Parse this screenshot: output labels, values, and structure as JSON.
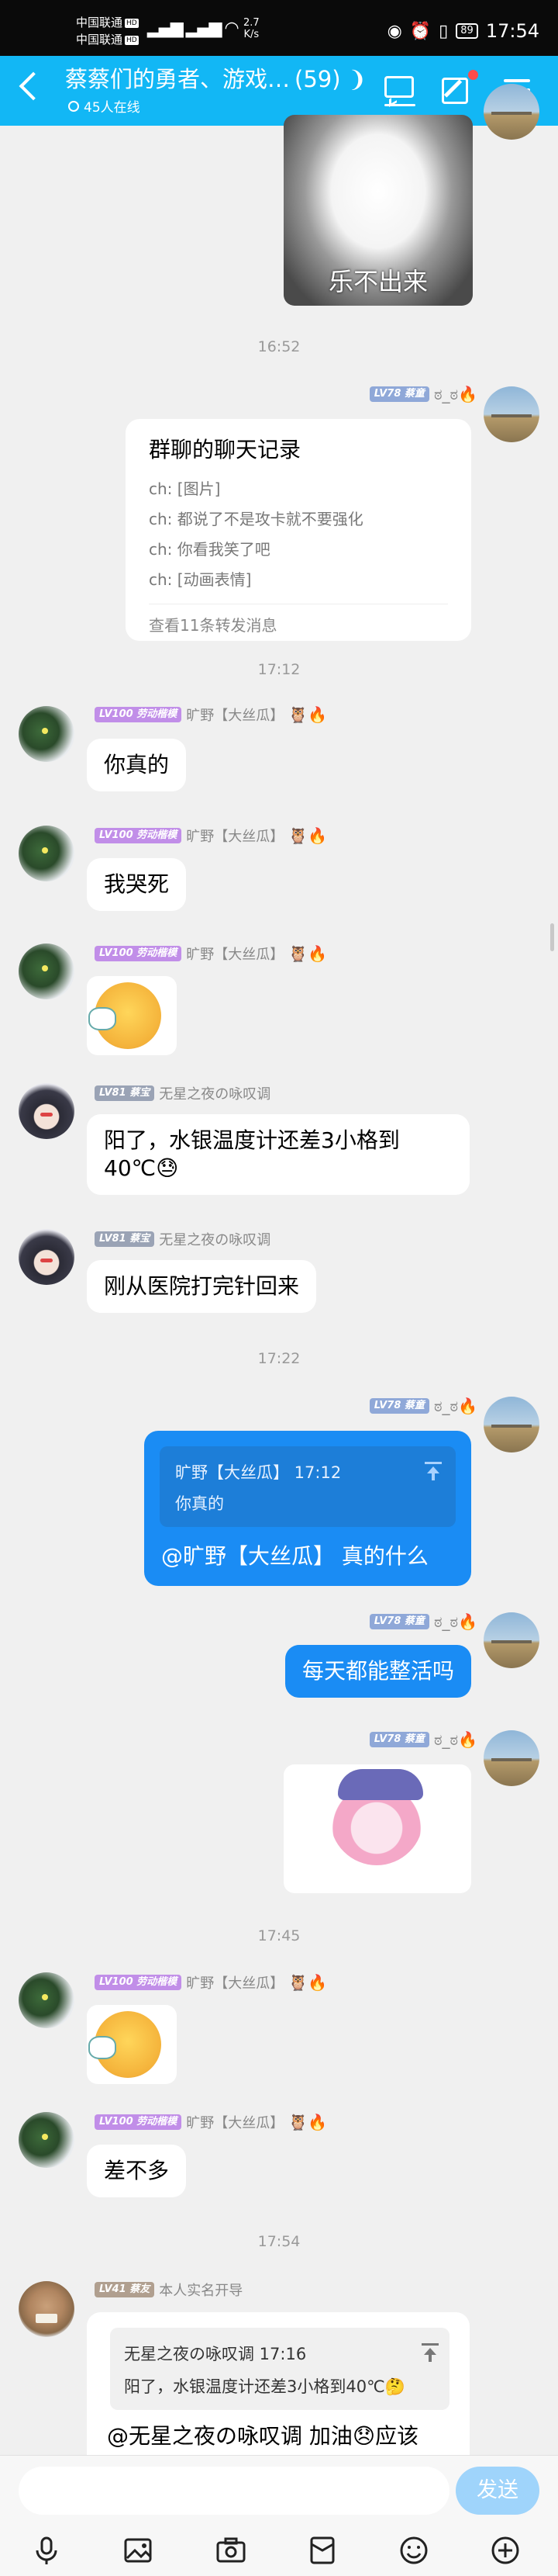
{
  "status_bar": {
    "carrier1": "中国联通",
    "carrier2": "中国联通",
    "hd": "HD",
    "speed_value": "2.7",
    "speed_unit": "K/s",
    "battery": "89",
    "time": "17:54"
  },
  "header": {
    "title": "蔡蔡们的勇者、游戏…",
    "member_count": "(59)",
    "online": "45人在线"
  },
  "messages": {
    "m1": {
      "image_caption": "乐不出来"
    },
    "t1": "16:52",
    "m2": {
      "level": "LV78",
      "name": "蔡童",
      "badge": "ಠ_ಠ🔥",
      "forward_title": "群聊的聊天记录",
      "forward_lines": [
        "ch: [图片]",
        "ch: 都说了不是攻卡就不要强化",
        "ch: 你看我笑了吧",
        "ch: [动画表情]"
      ],
      "forward_more": "查看11条转发消息"
    },
    "t2": "17:12",
    "m3": {
      "level": "LV100",
      "name": "劳动楷模",
      "title": "旷野【大丝瓜】",
      "badge": "🦉🔥",
      "text": "你真的"
    },
    "m4": {
      "level": "LV100",
      "name": "劳动楷模",
      "title": "旷野【大丝瓜】",
      "badge": "🦉🔥",
      "text": "我哭死"
    },
    "m5": {
      "level": "LV100",
      "name": "劳动楷模",
      "title": "旷野【大丝瓜】",
      "badge": "🦉🔥"
    },
    "m6": {
      "level": "LV81",
      "name": "蔡宝",
      "title": "无星之夜の咏叹调",
      "text": "阳了，水银温度计还差3小格到",
      "text2": "40℃😓"
    },
    "m7": {
      "level": "LV81",
      "name": "蔡宝",
      "title": "无星之夜の咏叹调",
      "text": "刚从医院打完针回来"
    },
    "t3": "17:22",
    "m8": {
      "level": "LV78",
      "name": "蔡童",
      "badge": "ಠ_ಠ🔥",
      "quote_head": "旷野【大丝瓜】 17:12",
      "quote_text": "你真的",
      "text": "@旷野【大丝瓜】 真的什么"
    },
    "m9": {
      "level": "LV78",
      "name": "蔡童",
      "badge": "ಠ_ಠ🔥",
      "text": "每天都能整活吗"
    },
    "m10": {
      "level": "LV78",
      "name": "蔡童",
      "badge": "ಠ_ಠ🔥"
    },
    "t4": "17:45",
    "m11": {
      "level": "LV100",
      "name": "劳动楷模",
      "title": "旷野【大丝瓜】",
      "badge": "🦉🔥"
    },
    "m12": {
      "level": "LV100",
      "name": "劳动楷模",
      "title": "旷野【大丝瓜】",
      "badge": "🦉🔥",
      "text": "差不多"
    },
    "t5": "17:54",
    "m13": {
      "level": "LV41",
      "name": "蔡友",
      "title": "本人实名开导",
      "quote_head": "无星之夜の咏叹调 17:16",
      "quote_text": "阳了，水银温度计还差3小格到40℃🤔",
      "text": "@无星之夜の咏叹调 加油😞应该"
    }
  },
  "input_bar": {
    "placeholder": "",
    "send_label": "发送"
  },
  "toolbar": {
    "icons": [
      "mic-icon",
      "image-icon",
      "camera-icon",
      "red-packet-icon",
      "emoji-icon",
      "plus-icon"
    ]
  },
  "colors": {
    "header": "#12b7f5",
    "bubble_self": "#1a8cf4",
    "send_button": "#9fd4fb"
  }
}
